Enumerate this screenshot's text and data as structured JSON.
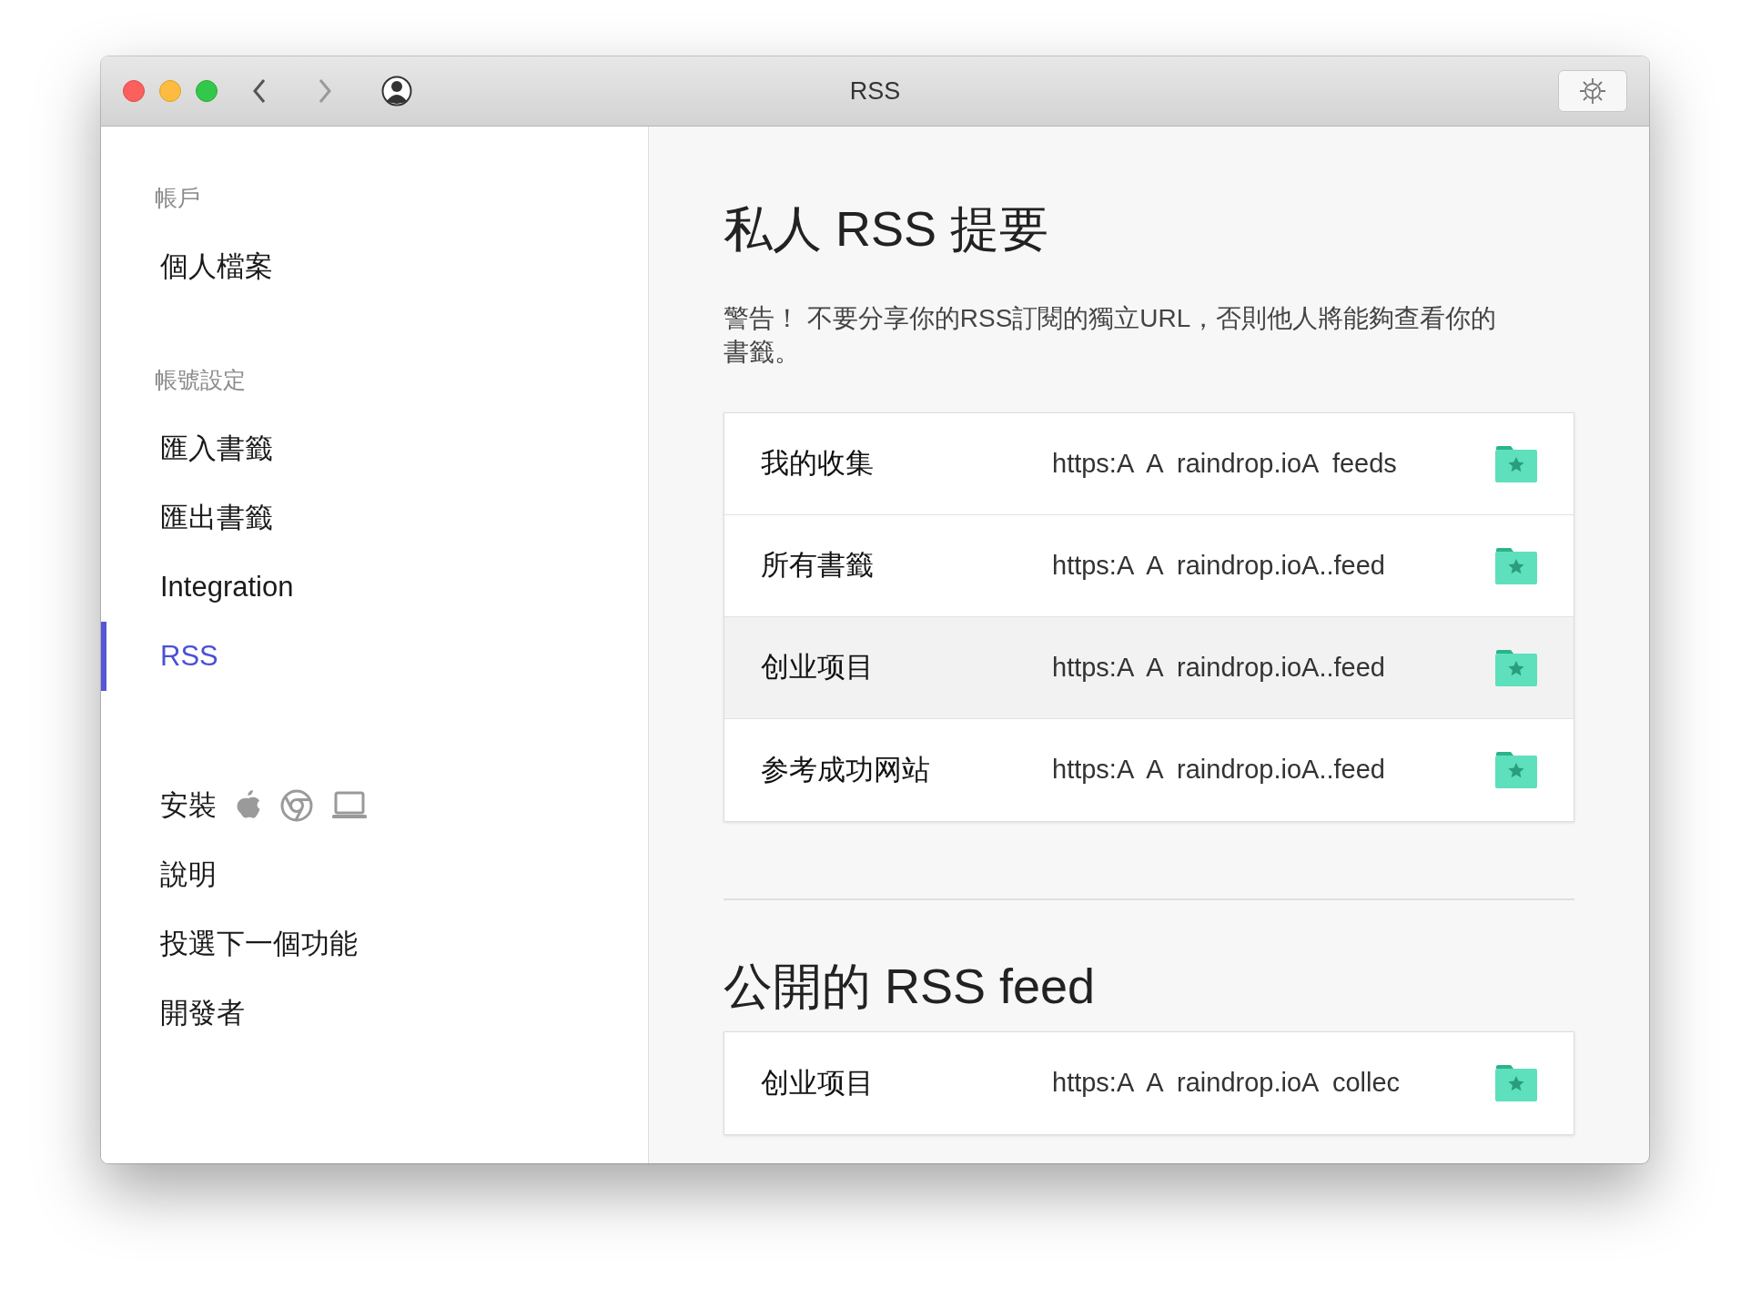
{
  "window": {
    "title": "RSS"
  },
  "sidebar": {
    "sections": [
      {
        "label": "帳戶",
        "items": [
          {
            "label": "個人檔案",
            "selected": false
          }
        ]
      },
      {
        "label": "帳號設定",
        "items": [
          {
            "label": "匯入書籤",
            "selected": false
          },
          {
            "label": "匯出書籤",
            "selected": false
          },
          {
            "label": "Integration",
            "selected": false
          },
          {
            "label": "RSS",
            "selected": true
          }
        ]
      }
    ],
    "install_label": "安裝",
    "links": [
      "說明",
      "投選下一個功能",
      "開發者"
    ]
  },
  "main": {
    "sections": [
      {
        "title": "私人 RSS 提要",
        "warning": "警告！ 不要分享你的RSS訂閱的獨立URL，否則他人將能夠查看你的書籤。",
        "feeds": [
          {
            "name": "我的收集",
            "url": "https:A  A  raindrop.ioA  feeds",
            "highlighted": false
          },
          {
            "name": "所有書籤",
            "url": "https:A  A  raindrop.ioA..feed",
            "highlighted": false
          },
          {
            "name": "创业项目",
            "url": "https:A  A  raindrop.ioA..feed",
            "highlighted": true
          },
          {
            "name": "参考成功网站",
            "url": "https:A  A  raindrop.ioA..feed",
            "highlighted": false
          }
        ]
      },
      {
        "title": "公開的 RSS feed",
        "feeds": [
          {
            "name": "创业项目",
            "url": "https:A  A  raindrop.ioA  collec",
            "highlighted": false
          }
        ]
      }
    ]
  }
}
